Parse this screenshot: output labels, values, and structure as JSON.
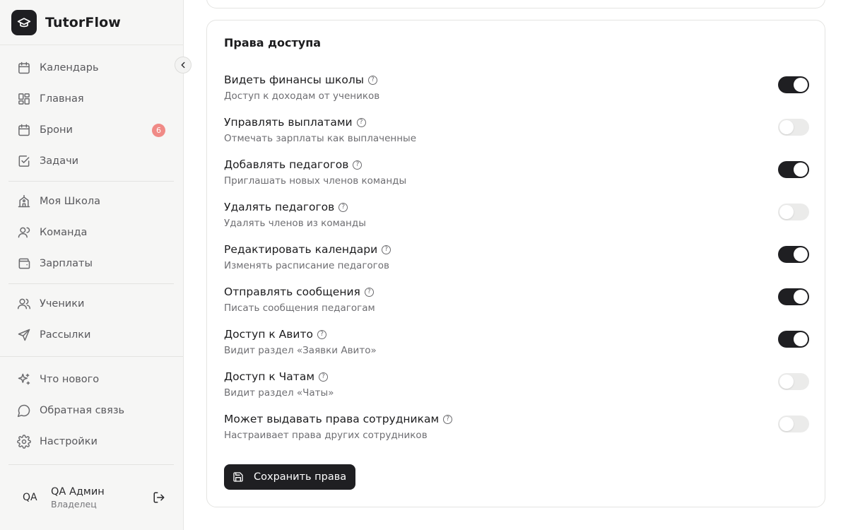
{
  "app": {
    "name": "TutorFlow"
  },
  "nav": {
    "group1": [
      {
        "label": "Календарь",
        "icon": "calendar-icon"
      },
      {
        "label": "Главная",
        "icon": "dashboard-icon"
      },
      {
        "label": "Брони",
        "icon": "calendar-icon",
        "badge": "6"
      },
      {
        "label": "Задачи",
        "icon": "checkbox-icon"
      }
    ],
    "group2": [
      {
        "label": "Моя Школа",
        "icon": "school-icon"
      },
      {
        "label": "Команда",
        "icon": "user-icon"
      },
      {
        "label": "Зарплаты",
        "icon": "wallet-icon"
      }
    ],
    "group3": [
      {
        "label": "Ученики",
        "icon": "users-icon"
      },
      {
        "label": "Рассылки",
        "icon": "send-icon"
      }
    ],
    "group4": [
      {
        "label": "Что нового",
        "icon": "sparkles-icon"
      },
      {
        "label": "Обратная связь",
        "icon": "message-icon"
      },
      {
        "label": "Настройки",
        "icon": "gear-icon"
      }
    ]
  },
  "user": {
    "initials": "QA",
    "name": "QA Админ",
    "role": "Владелец"
  },
  "permissions": {
    "title": "Права доступа",
    "help_glyph": "?",
    "items": [
      {
        "title": "Видеть финансы школы",
        "desc": "Доступ к доходам от учеников",
        "enabled": true
      },
      {
        "title": "Управлять выплатами",
        "desc": "Отмечать зарплаты как выплаченные",
        "enabled": false
      },
      {
        "title": "Добавлять педагогов",
        "desc": "Приглашать новых членов команды",
        "enabled": true
      },
      {
        "title": "Удалять педагогов",
        "desc": "Удалять членов из команды",
        "enabled": false
      },
      {
        "title": "Редактировать календари",
        "desc": "Изменять расписание педагогов",
        "enabled": true
      },
      {
        "title": "Отправлять сообщения",
        "desc": "Писать сообщения педагогам",
        "enabled": true
      },
      {
        "title": "Доступ к Авито",
        "desc": "Видит раздел «Заявки Авито»",
        "enabled": true
      },
      {
        "title": "Доступ к Чатам",
        "desc": "Видит раздел «Чаты»",
        "enabled": false
      },
      {
        "title": "Может выдавать права сотрудникам",
        "desc": "Настраивает права других сотрудников",
        "enabled": false
      }
    ],
    "save_label": "Сохранить права"
  },
  "colors": {
    "accent": "#1f1f22",
    "badge": "#f08a86",
    "toggle_off": "#ebebea"
  }
}
